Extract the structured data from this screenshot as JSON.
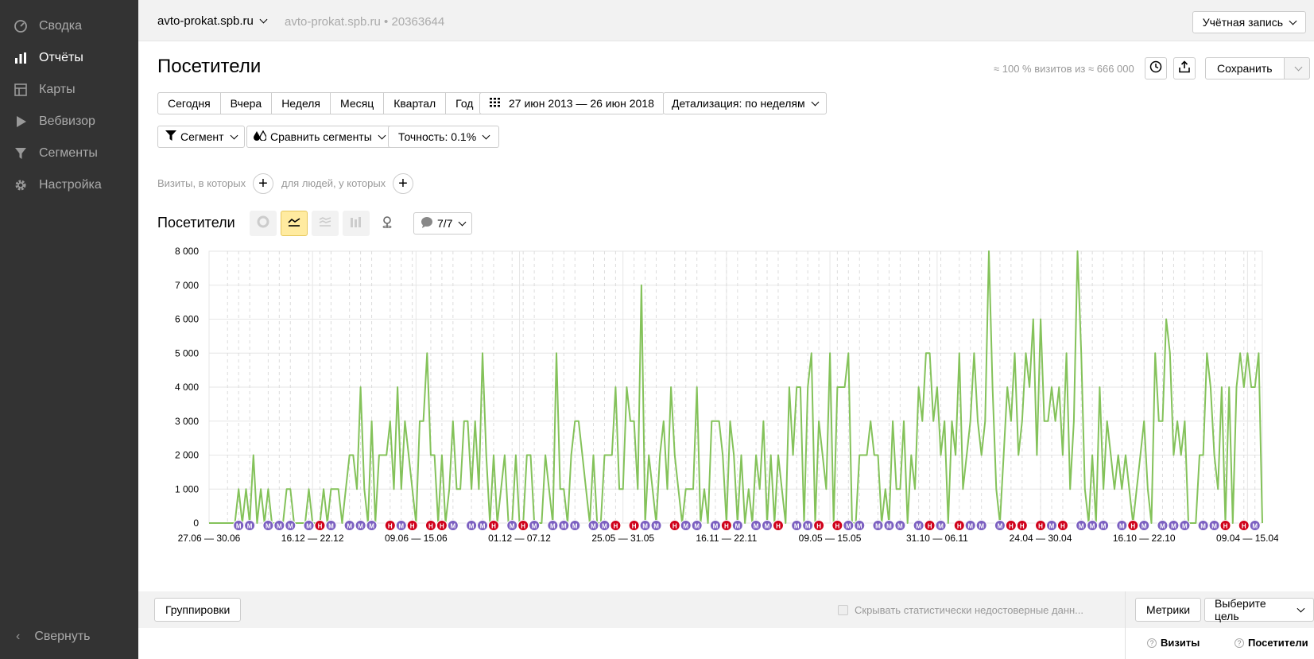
{
  "sidebar": {
    "items": [
      {
        "label": "Сводка",
        "icon": "dashboard-icon",
        "active": false
      },
      {
        "label": "Отчёты",
        "icon": "bar-chart-icon",
        "active": true
      },
      {
        "label": "Карты",
        "icon": "map-icon",
        "active": false
      },
      {
        "label": "Вебвизор",
        "icon": "play-icon",
        "active": false
      },
      {
        "label": "Сегменты",
        "icon": "filter-icon",
        "active": false
      },
      {
        "label": "Настройка",
        "icon": "gear-icon",
        "active": false
      }
    ],
    "collapse_label": "Свернуть"
  },
  "header": {
    "site": "avto-prokat.spb.ru",
    "site_meta": "avto-prokat.spb.ru • 20363644",
    "account_button": "Учётная запись"
  },
  "report": {
    "title": "Посетители",
    "visits_note": "≈ 100 % визитов из ≈ 666 000",
    "save_button": "Сохранить",
    "periods": [
      "Сегодня",
      "Вчера",
      "Неделя",
      "Месяц",
      "Квартал",
      "Год"
    ],
    "date_range": "27 июн 2013 — 26 июн 2018",
    "detail": "Детализация: по неделям",
    "segment_button": "Сегмент",
    "compare_button": "Сравнить сегменты",
    "accuracy_button": "Точность: 0.1%",
    "visits_condition": "Визиты, в которых",
    "people_condition": "для людей, у которых"
  },
  "chart_panel": {
    "title": "Посетители",
    "notes_count": "7/7"
  },
  "chart_data": {
    "type": "line",
    "title": "",
    "xlabel": "",
    "ylabel": "",
    "ylim": [
      0,
      8000
    ],
    "grid": true,
    "color": "#84c25a",
    "y_tick_labels": [
      "0",
      "1 000",
      "2 000",
      "3 000",
      "4 000",
      "5 000",
      "6 000",
      "7 000",
      "8 000"
    ],
    "x_tick_labels": [
      "27.06 — 30.06",
      "16.12 — 22.12",
      "09.06 — 15.06",
      "01.12 — 07.12",
      "25.05 — 31.05",
      "16.11 — 22.11",
      "09.05 — 15.05",
      "31.10 — 06.11",
      "24.04 — 30.04",
      "16.10 — 22.10",
      "09.04 — 15.04"
    ],
    "series": [
      {
        "values": [
          0,
          0,
          0,
          0,
          0,
          0,
          0,
          0,
          1000,
          0,
          1000,
          0,
          2000,
          0,
          1000,
          0,
          1000,
          0,
          0,
          0,
          0,
          1000,
          1000,
          0,
          0,
          0,
          0,
          1000,
          0,
          0,
          0,
          1000,
          0,
          1000,
          1000,
          1000,
          0,
          1000,
          2000,
          2000,
          1000,
          4000,
          1000,
          0,
          3000,
          0,
          2000,
          2000,
          2000,
          3000,
          1000,
          4000,
          1000,
          3000,
          2000,
          1000,
          0,
          3000,
          3000,
          5000,
          2000,
          2000,
          0,
          2000,
          0,
          1000,
          3000,
          1000,
          1000,
          3000,
          3000,
          1000,
          3000,
          1000,
          5000,
          2000,
          0,
          2000,
          0,
          1000,
          2000,
          0,
          0,
          2000,
          0,
          0,
          2000,
          2000,
          0,
          0,
          0,
          2000,
          1000,
          0,
          5000,
          1000,
          1000,
          0,
          2000,
          3000,
          3000,
          2000,
          1000,
          0,
          2000,
          0,
          0,
          2000,
          2000,
          2000,
          4000,
          1000,
          1000,
          4000,
          3000,
          3000,
          1000,
          7000,
          0,
          2000,
          1000,
          0,
          2000,
          3000,
          1000,
          4000,
          2000,
          1000,
          0,
          1000,
          1000,
          1000,
          4000,
          0,
          1000,
          0,
          3000,
          3000,
          3000,
          2000,
          0,
          3000,
          2000,
          0,
          2000,
          0,
          1000,
          0,
          2000,
          1000,
          3000,
          0,
          2000,
          0,
          2000,
          1000,
          0,
          4000,
          2000,
          4000,
          4000,
          0,
          4000,
          5000,
          0,
          3000,
          2000,
          1000,
          5000,
          0,
          4000,
          4000,
          4000,
          5000,
          0,
          0,
          2000,
          2000,
          2000,
          3000,
          2000,
          2000,
          0,
          1000,
          0,
          3000,
          1000,
          1000,
          3000,
          0,
          2000,
          1000,
          4000,
          3000,
          5000,
          5000,
          3000,
          4000,
          2000,
          3000,
          0,
          3000,
          2000,
          5000,
          1000,
          2000,
          3000,
          5000,
          3000,
          2000,
          3000,
          8000,
          4000,
          1000,
          0,
          2000,
          4000,
          3000,
          5000,
          2000,
          3000,
          5000,
          4000,
          6000,
          2000,
          6000,
          3000,
          3000,
          4000,
          3000,
          4000,
          2000,
          5000,
          1000,
          3000,
          8000,
          5000,
          1000,
          0,
          2000,
          0,
          4000,
          1000,
          3000,
          2000,
          1000,
          2000,
          1000,
          2000,
          1000,
          0,
          1000,
          2000,
          3000,
          1000,
          0,
          5000,
          3000,
          3000,
          6000,
          5000,
          2000,
          3000,
          2000,
          3000,
          0,
          0,
          0,
          2000,
          2000,
          5000,
          4000,
          2000,
          1000,
          4000,
          0,
          4000,
          0,
          4000,
          5000,
          4000,
          5000,
          4000,
          4000,
          5000,
          0
        ]
      }
    ],
    "annotations": [
      {
        "label": "М",
        "color": "#7b5fc0"
      },
      {
        "label": "Н",
        "color": "#d0021b"
      }
    ]
  },
  "bottom": {
    "groupings_button": "Группировки",
    "hide_unreliable": "Скрывать статистически недостоверные данн...",
    "metrics_button": "Метрики",
    "goal_button": "Выберите цель",
    "columns": [
      "Визиты",
      "Посетители"
    ],
    "help_mark": "?"
  }
}
